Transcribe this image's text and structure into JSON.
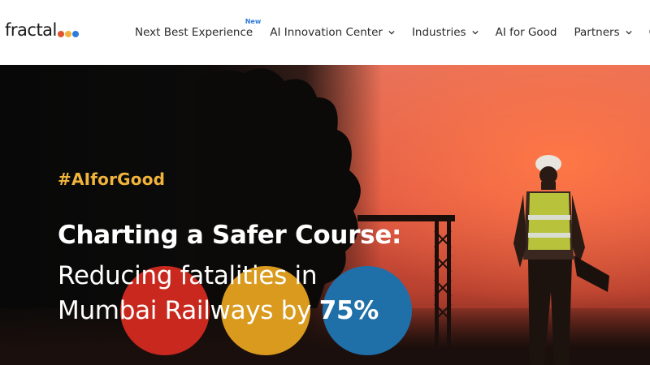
{
  "brand": {
    "logo_text": "fractal",
    "dot_colors": [
      "#e0552f",
      "#f0b43c",
      "#2f7bd8"
    ]
  },
  "nav": {
    "items": [
      {
        "label": "Next Best Experience",
        "badge": "New",
        "dropdown": false
      },
      {
        "label": "AI Innovation Center",
        "dropdown": true
      },
      {
        "label": "Industries",
        "dropdown": true
      },
      {
        "label": "AI for Good",
        "dropdown": false
      },
      {
        "label": "Partners",
        "dropdown": true
      },
      {
        "label": "Co",
        "dropdown": false
      }
    ]
  },
  "hero": {
    "hashtag": "#AIforGood",
    "headline": "Charting a Safer Course:",
    "subline_1": "Reducing fatalities in",
    "subline_2": "Mumbai Railways by ",
    "subline_highlight": "75%",
    "circle_colors": [
      "#c8281e",
      "#d99a1e",
      "#1f6fa8"
    ]
  }
}
